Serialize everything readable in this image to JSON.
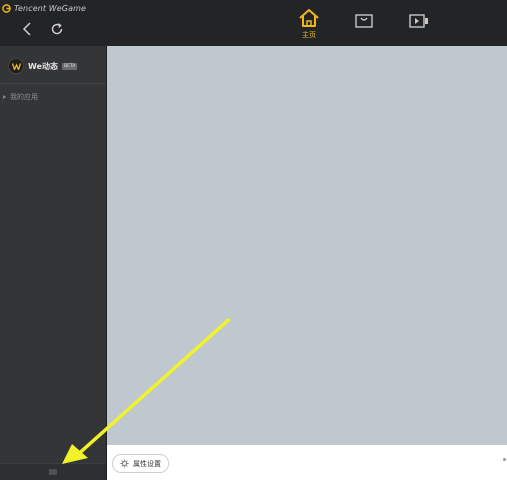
{
  "app": {
    "brand_name": "Tencent WeGame"
  },
  "header": {
    "tabs": [
      {
        "label": "主页",
        "icon": "home-icon",
        "active": true
      },
      {
        "label": "",
        "icon": "store-bag-icon",
        "active": false
      },
      {
        "label": "",
        "icon": "video-icon",
        "active": false
      }
    ]
  },
  "sidebar": {
    "we_title": "We动态",
    "we_badge": "BETA",
    "my_apps_label": "我的应用",
    "bottom_icon": "menu-icon"
  },
  "footer": {
    "settings_label": "属性设置"
  },
  "colors": {
    "accent": "#f0b81c",
    "content_bg": "#bfc7cf",
    "arrow": "#f2f22a"
  }
}
